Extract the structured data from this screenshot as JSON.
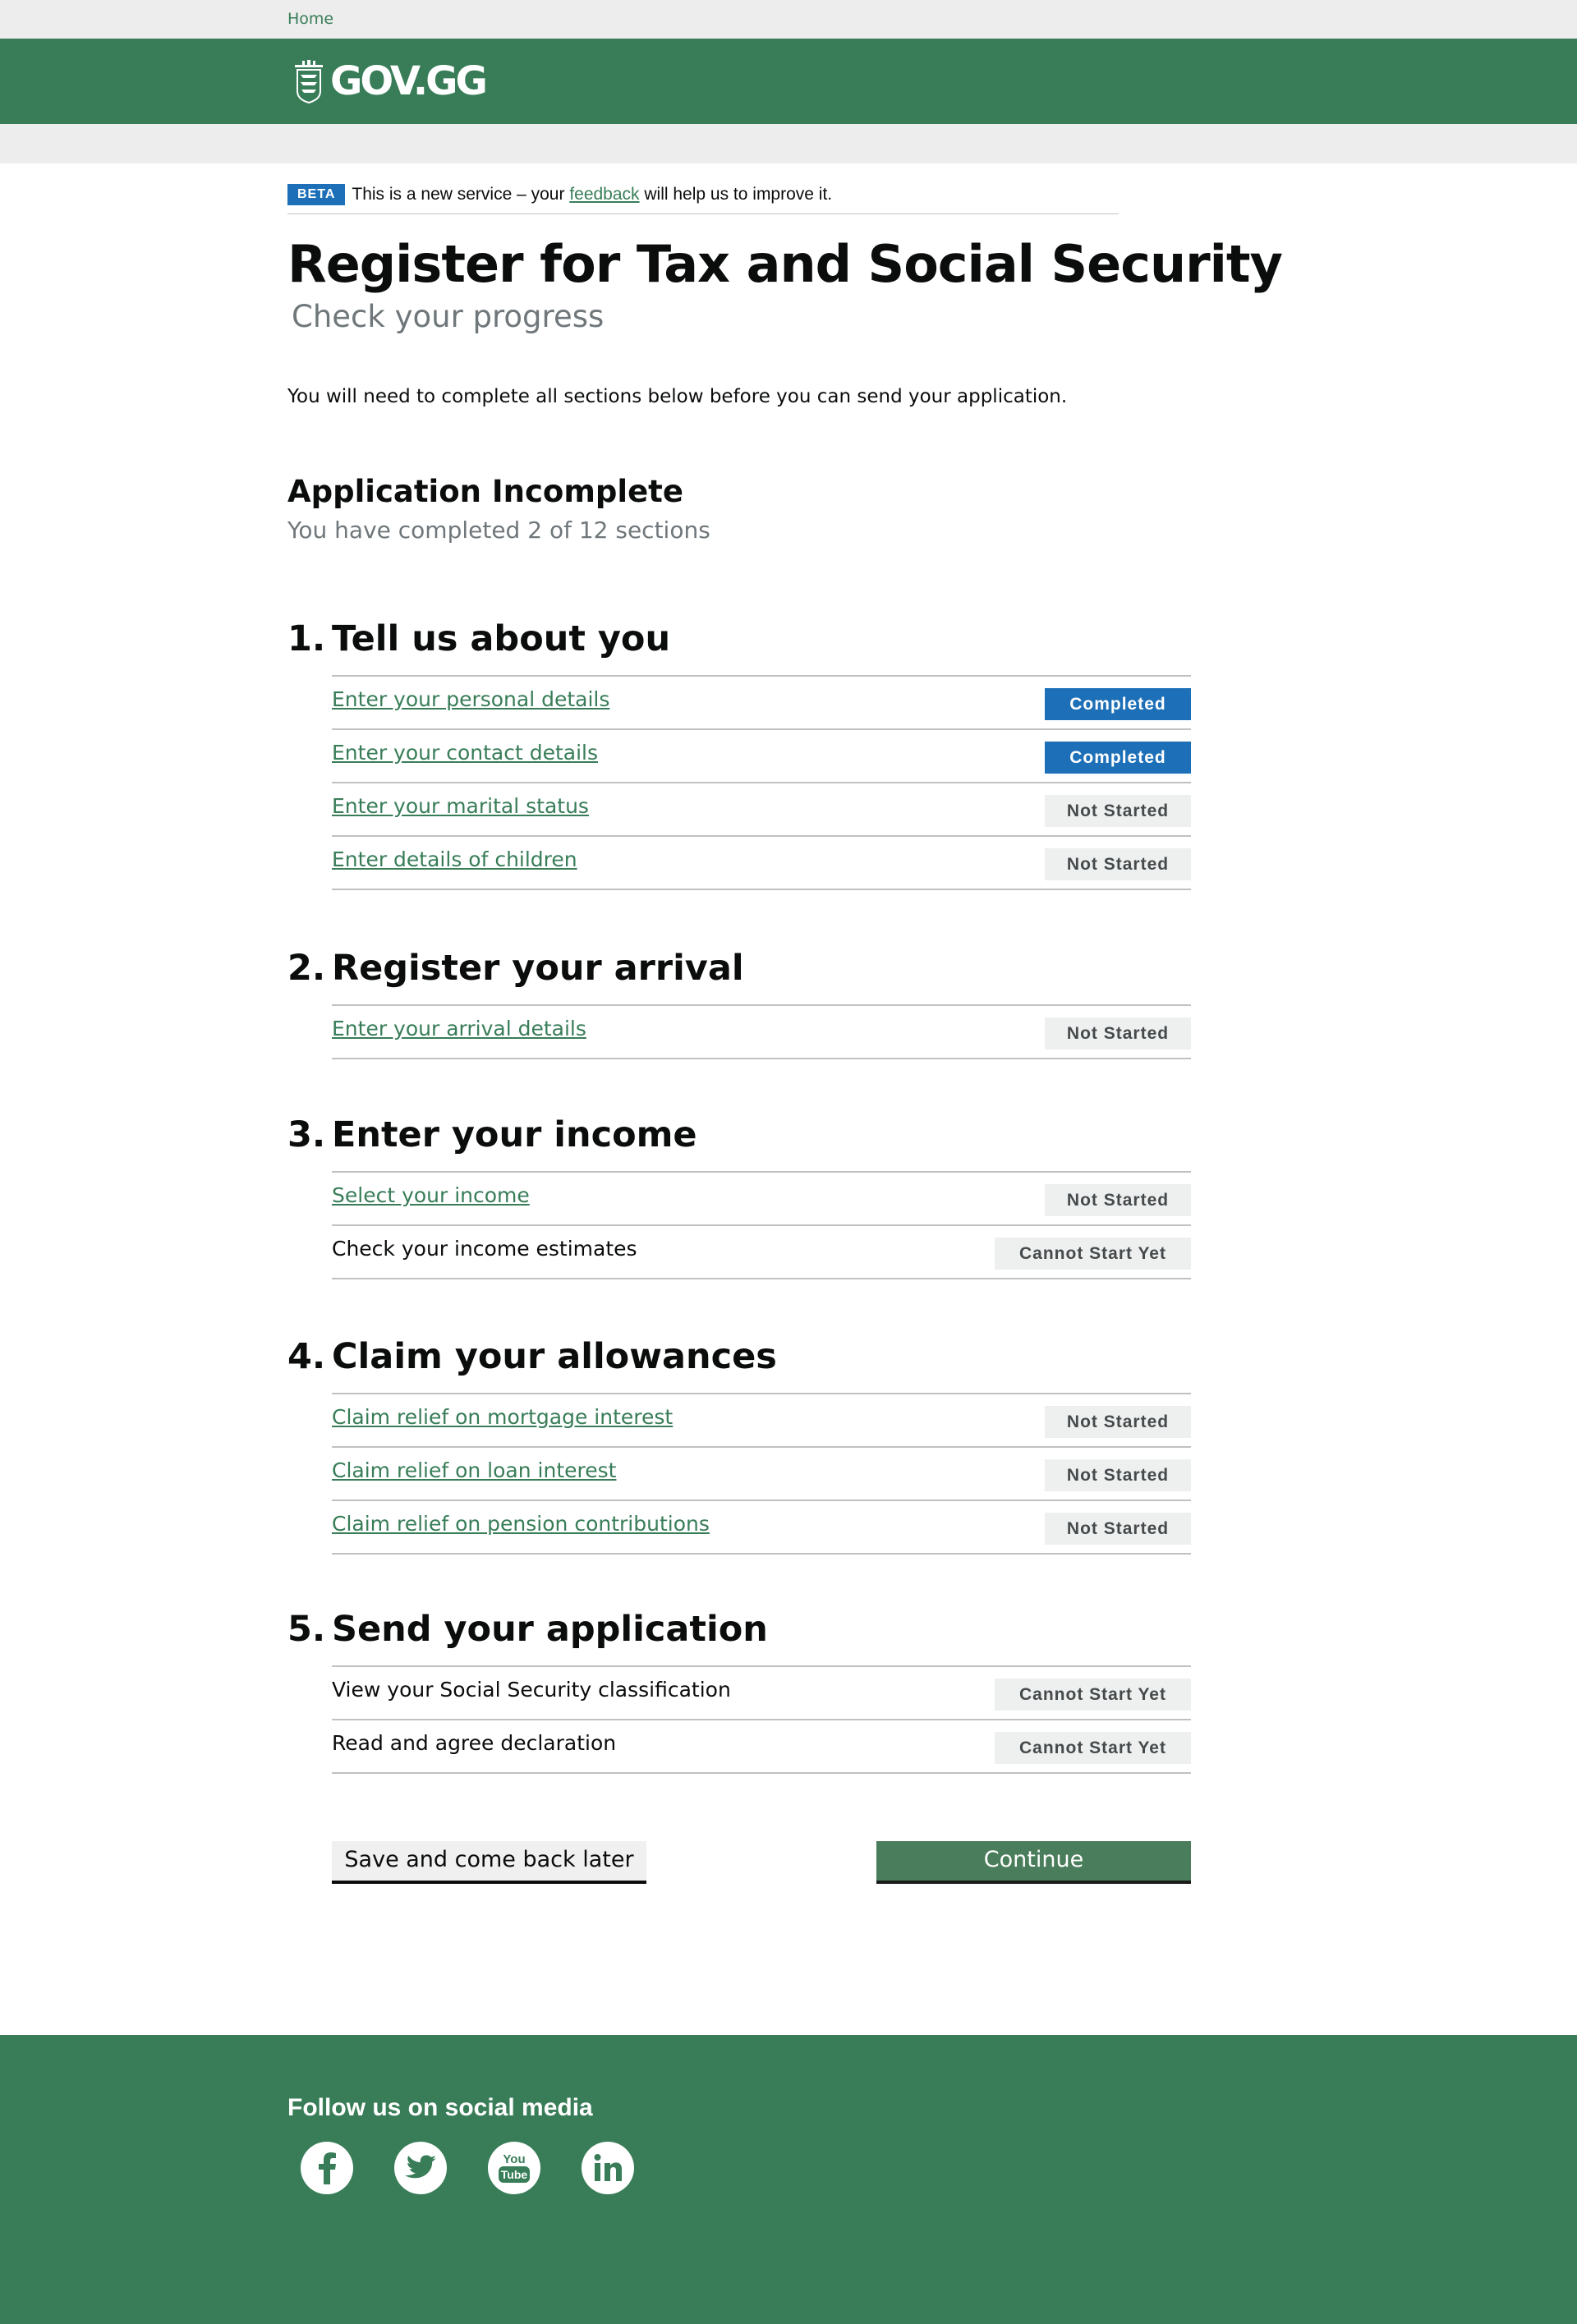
{
  "topbar": {
    "home_link": "Home"
  },
  "header": {
    "logo_text": "GOV.GG"
  },
  "beta": {
    "tag": "BETA",
    "text_before": "This is a new service – your ",
    "link": "feedback",
    "text_after": " will help us to improve it."
  },
  "page": {
    "title": "Register for Tax and Social Security",
    "subtitle": "Check your progress",
    "intro": "You will need to complete all sections below before you can send your application."
  },
  "status": {
    "heading": "Application Incomplete",
    "progress": "You have completed 2 of 12 sections"
  },
  "sections": [
    {
      "number": "1.",
      "title": "Tell us about you",
      "tasks": [
        {
          "name": "Enter your personal details",
          "status": "Completed"
        },
        {
          "name": "Enter your contact details",
          "status": "Completed"
        },
        {
          "name": "Enter your marital status",
          "status": "Not Started"
        },
        {
          "name": "Enter details of children",
          "status": "Not Started"
        }
      ]
    },
    {
      "number": "2.",
      "title": "Register your arrival",
      "tasks": [
        {
          "name": "Enter your arrival details",
          "status": "Not Started"
        }
      ]
    },
    {
      "number": "3.",
      "title": "Enter your income",
      "tasks": [
        {
          "name": "Select your income",
          "status": "Not Started"
        },
        {
          "name": "Check your income estimates",
          "status": "Cannot Start Yet"
        }
      ]
    },
    {
      "number": "4.",
      "title": "Claim your allowances",
      "tasks": [
        {
          "name": "Claim relief on mortgage interest",
          "status": "Not Started"
        },
        {
          "name": "Claim relief on loan interest",
          "status": "Not Started"
        },
        {
          "name": "Claim relief on pension contributions",
          "status": "Not Started"
        }
      ]
    },
    {
      "number": "5.",
      "title": "Send your application",
      "tasks": [
        {
          "name": "View your Social Security classification",
          "status": "Cannot Start Yet"
        },
        {
          "name": "Read and agree declaration",
          "status": "Cannot Start Yet"
        }
      ]
    }
  ],
  "buttons": {
    "save": "Save and come back later",
    "continue": "Continue"
  },
  "footer": {
    "heading": "Follow us on social media",
    "social_icons": [
      "facebook-icon",
      "twitter-icon",
      "youtube-icon",
      "linkedin-icon"
    ],
    "youtube_you": "You",
    "youtube_tube": "Tube"
  },
  "colors": {
    "brand_green": "#387d58",
    "completed_blue": "#1d70b8",
    "tag_grey": "#eeefef",
    "link_green": "#387d58"
  }
}
